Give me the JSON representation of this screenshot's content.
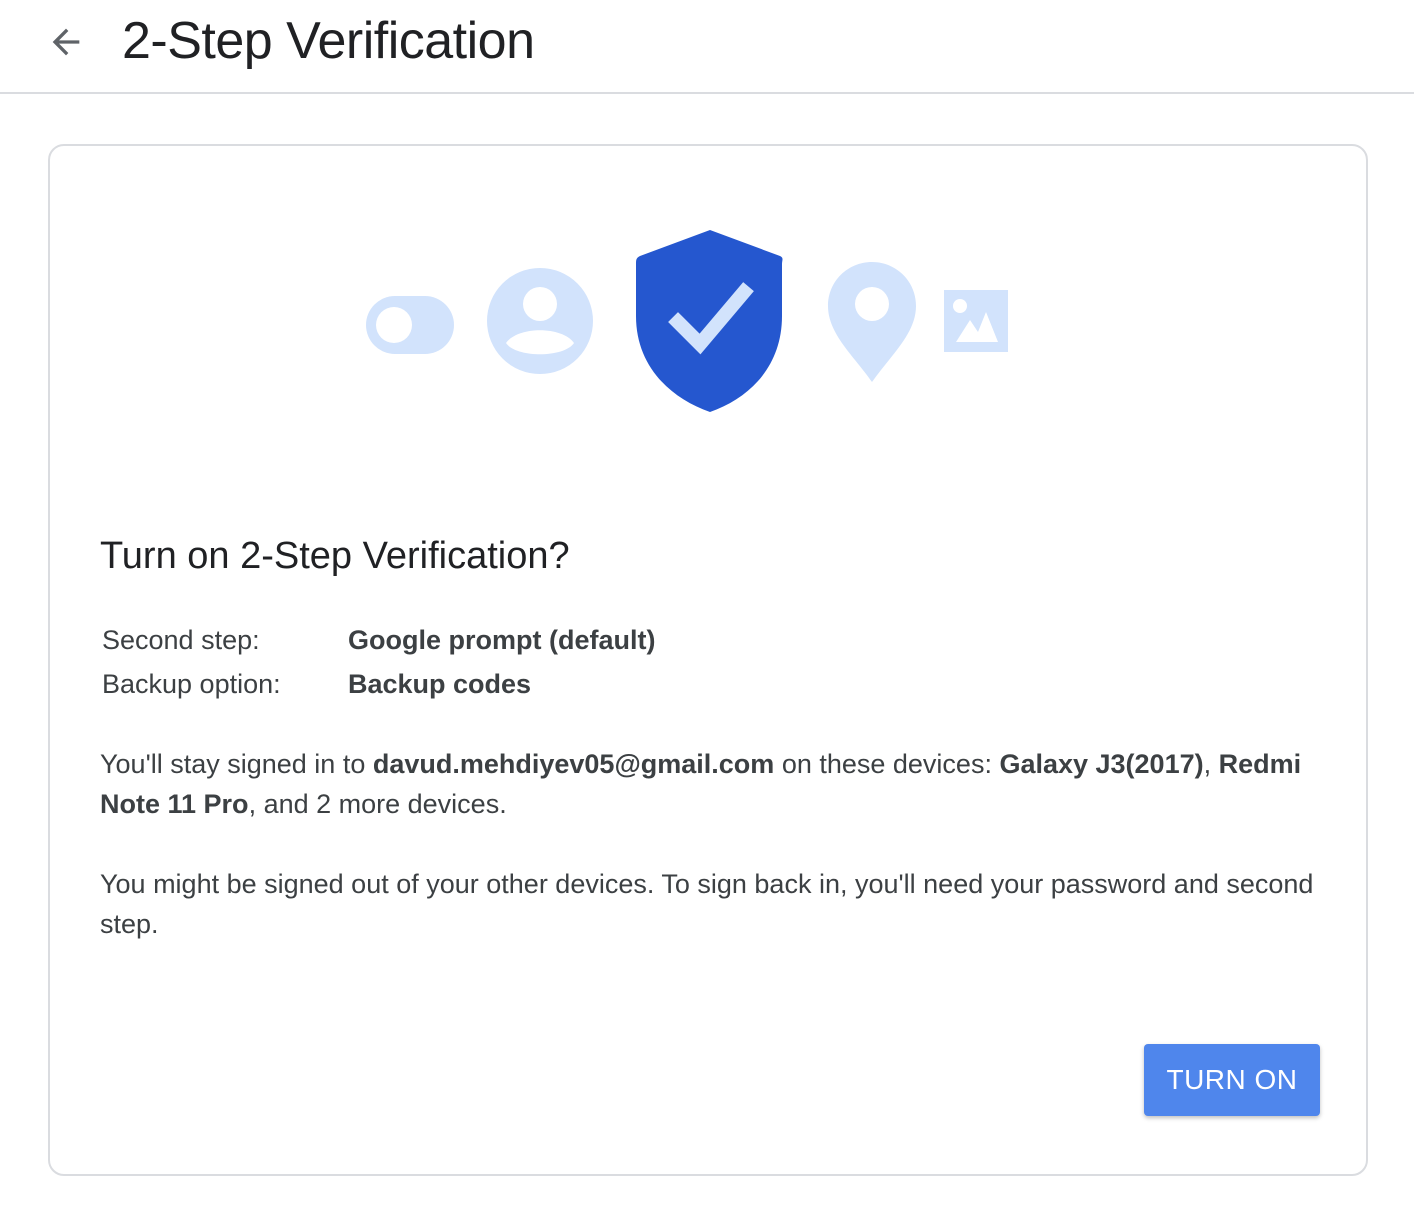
{
  "header": {
    "title": "2-Step Verification",
    "back_icon": "arrow-back-icon"
  },
  "illustration": {
    "icons": [
      "toggle-icon",
      "account-circle-icon",
      "shield-check-icon",
      "location-pin-icon",
      "image-icon"
    ],
    "colors": {
      "light_blue": "#d2e3fc",
      "shield_blue": "#2557cf",
      "check": "#d2e3fc"
    }
  },
  "dialog": {
    "title": "Turn on 2-Step Verification?",
    "settings": [
      {
        "label": "Second step:",
        "value": "Google prompt (default)"
      },
      {
        "label": "Backup option:",
        "value": "Backup codes"
      }
    ],
    "devices_text": {
      "prefix": "You'll stay signed in to ",
      "email": "davud.mehdiyev05@gmail.com",
      "middle": " on these devices: ",
      "device1": "Galaxy J3(2017)",
      "comma": ",",
      "device2": "Redmi Note 11 Pro",
      "suffix": ", and 2 more devices."
    },
    "signout_text": "You might be signed out of your other devices. To sign back in, you'll need your password and second step.",
    "turn_on_label": "TURN ON"
  },
  "colors": {
    "button_bg": "#4f86ec",
    "border": "#dadce0",
    "text": "#202124"
  }
}
